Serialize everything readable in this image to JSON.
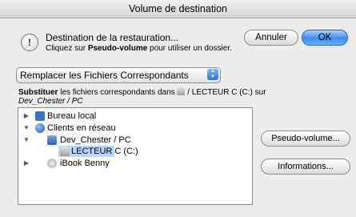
{
  "window": {
    "title": "Volume de destination"
  },
  "header": {
    "icon": "alert-icon",
    "icon_glyph": "!",
    "title": "Destination de la restauration...",
    "subtitle_pre": "Cliquez sur ",
    "subtitle_bold": "Pseudo-volume",
    "subtitle_post": " pour utiliser un dossier."
  },
  "buttons": {
    "cancel": "Annuler",
    "ok": "OK"
  },
  "popup": {
    "selected": "Remplacer les Fichiers Correspondants"
  },
  "description": {
    "bold": "Substituer",
    "text": " les fichiers correspondants dans ",
    "path": "/ LECTEUR C (C:) sur",
    "italic": "Dev_Chester / PC"
  },
  "tree": {
    "items": [
      {
        "label": "Bureau local",
        "expanded": false,
        "icon": "desktop-icon"
      },
      {
        "label": "Clients en réseau",
        "expanded": true,
        "icon": "globe-icon"
      },
      {
        "label": "Dev_Chester / PC",
        "expanded": true,
        "icon": "network-client-icon"
      },
      {
        "label": "LECTEUR C (C:)",
        "selected": true,
        "icon": "drive-icon"
      },
      {
        "label": "iBook Benny",
        "expanded": false,
        "icon": "ibook-icon"
      }
    ]
  },
  "side_buttons": {
    "pseudo": "Pseudo-volume...",
    "info": "Informations..."
  },
  "colors": {
    "ok_button": "#3f8bf1",
    "selection": "#b6d5ff",
    "window_bg": "#ececec"
  }
}
